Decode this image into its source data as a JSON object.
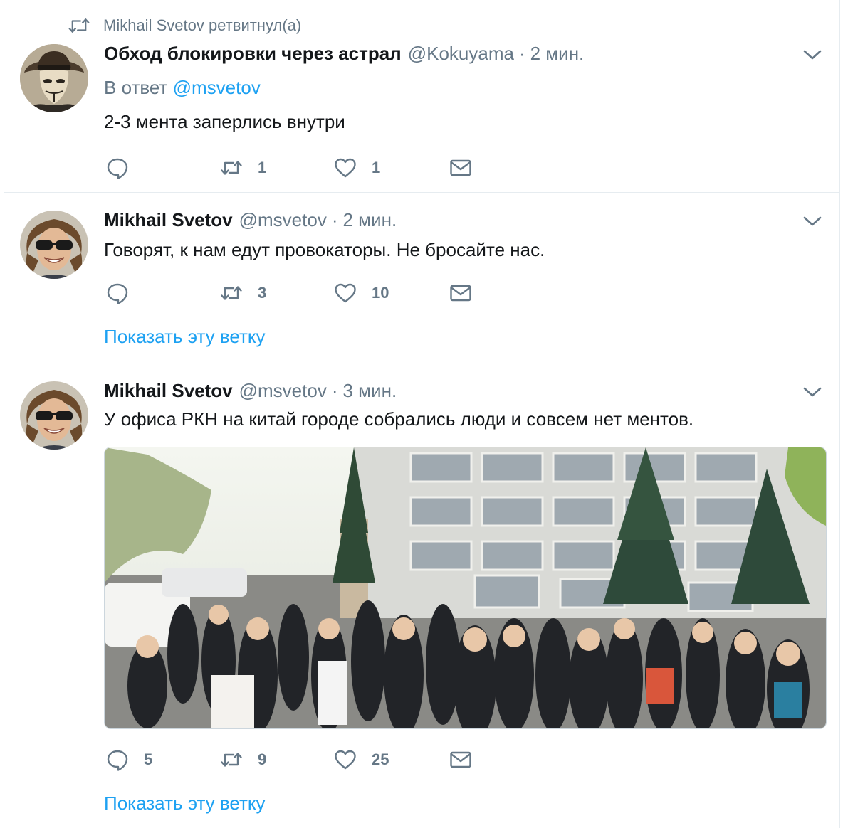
{
  "retweet_banner": {
    "text": "Mikhail Svetov ретвитнул(а)"
  },
  "tweets": [
    {
      "name": "Обход блокировки через астрал",
      "handle": "@Kokuyama",
      "dot": "·",
      "time": "2 мин.",
      "reply_prefix": "В ответ",
      "reply_handle": "@msvetov",
      "text": "2-3 мента заперлись внутри",
      "reply_count": "",
      "retweet_count": "1",
      "like_count": "1"
    },
    {
      "name": "Mikhail Svetov",
      "handle": "@msvetov",
      "dot": "·",
      "time": "2 мин.",
      "text": "Говорят, к нам едут провокаторы. Не бросайте нас.",
      "reply_count": "",
      "retweet_count": "3",
      "like_count": "10",
      "show_thread": "Показать эту ветку"
    },
    {
      "name": "Mikhail Svetov",
      "handle": "@msvetov",
      "dot": "·",
      "time": "3 мин.",
      "text": "У офиса РКН на китай городе собрались люди и совсем нет ментов.",
      "reply_count": "5",
      "retweet_count": "9",
      "like_count": "25",
      "show_thread": "Показать эту ветку"
    }
  ],
  "icons": {
    "retweet": "retweet-icon",
    "reply": "reply-icon",
    "like": "heart-icon",
    "dm": "envelope-icon",
    "menu": "chevron-down-icon"
  },
  "colors": {
    "link": "#1da1f2",
    "secondary": "#657786",
    "primary_text": "#14171a",
    "divider": "#e6ecf0"
  }
}
